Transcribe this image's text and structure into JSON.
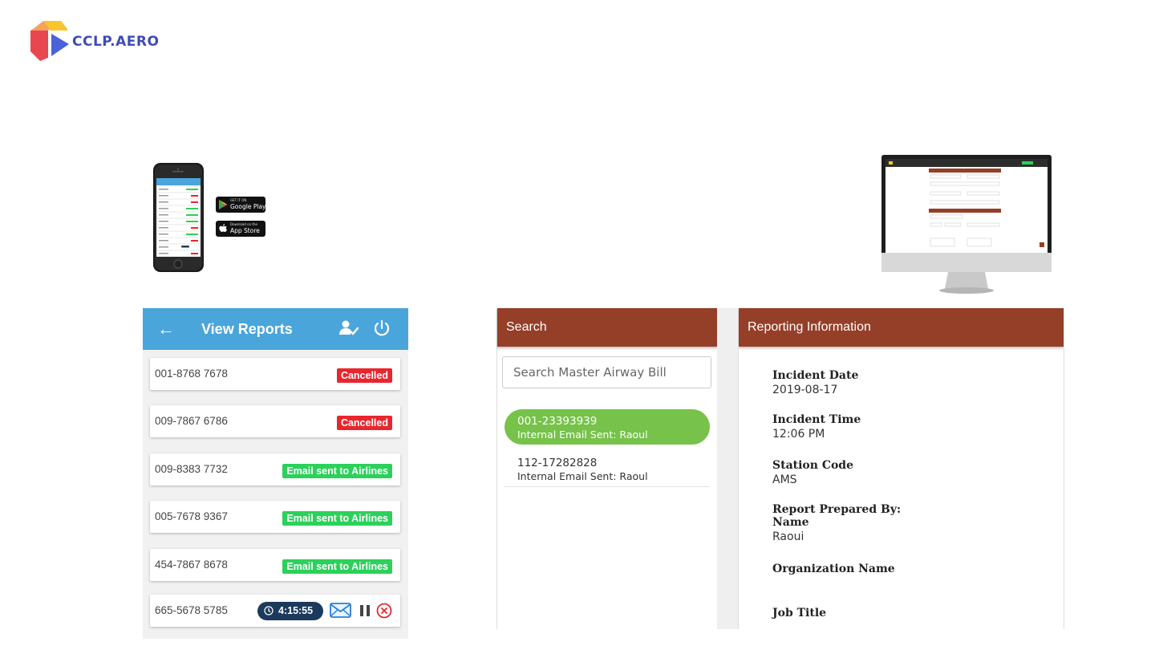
{
  "logo": {
    "text": "CCLP.AERO"
  },
  "store_badges": {
    "google": {
      "small": "GET IT ON",
      "big": "Google Play"
    },
    "apple": {
      "small": "Download on the",
      "big": "App Store"
    }
  },
  "mobile": {
    "header": {
      "back_icon": "arrow-left-icon",
      "title": "View Reports",
      "user_icon": "user-check-icon",
      "power_icon": "power-icon"
    },
    "reports": [
      {
        "number": "001-8768 7678",
        "status": "Cancelled",
        "status_color": "#e8262d"
      },
      {
        "number": "009-7867 6786",
        "status": "Cancelled",
        "status_color": "#e8262d"
      },
      {
        "number": "009-8383 7732",
        "status": "Email sent to Airlines",
        "status_color": "#2bd15a"
      },
      {
        "number": "005-7678 9367",
        "status": "Email sent to Airlines",
        "status_color": "#2bd15a"
      },
      {
        "number": "454-7867 8678",
        "status": "Email sent to Airlines",
        "status_color": "#2bd15a"
      },
      {
        "number": "665-5678 5785",
        "timer": "4:15:55",
        "actions": [
          "mail-icon",
          "pause-icon",
          "cancel-icon"
        ]
      }
    ]
  },
  "search": {
    "header": "Search",
    "placeholder": "Search Master Airway Bill",
    "results": [
      {
        "id": "001-23393939",
        "subtitle": "Internal Email Sent: Raoul",
        "active": true
      },
      {
        "id": "112-17282828",
        "subtitle": "Internal Email Sent: Raoul",
        "active": false
      }
    ]
  },
  "reporting": {
    "header": "Reporting Information",
    "fields": [
      {
        "label": "Incident Date",
        "value": "2019-08-17"
      },
      {
        "label": "Incident Time",
        "value": "12:06 PM"
      },
      {
        "label": "Station Code",
        "value": "AMS"
      },
      {
        "label": "Report Prepared By:",
        "label2": "Name",
        "value": "Raoui"
      },
      {
        "label": "Organization Name",
        "value": ""
      },
      {
        "label": "Job Title",
        "value": ""
      }
    ]
  },
  "colors": {
    "mobile_header": "#4aa5db",
    "panel_header": "#953f28",
    "active_result": "#76c24a",
    "badge_cancelled": "#e8262d",
    "badge_email": "#2bd15a",
    "timer": "#1b3a5c"
  }
}
